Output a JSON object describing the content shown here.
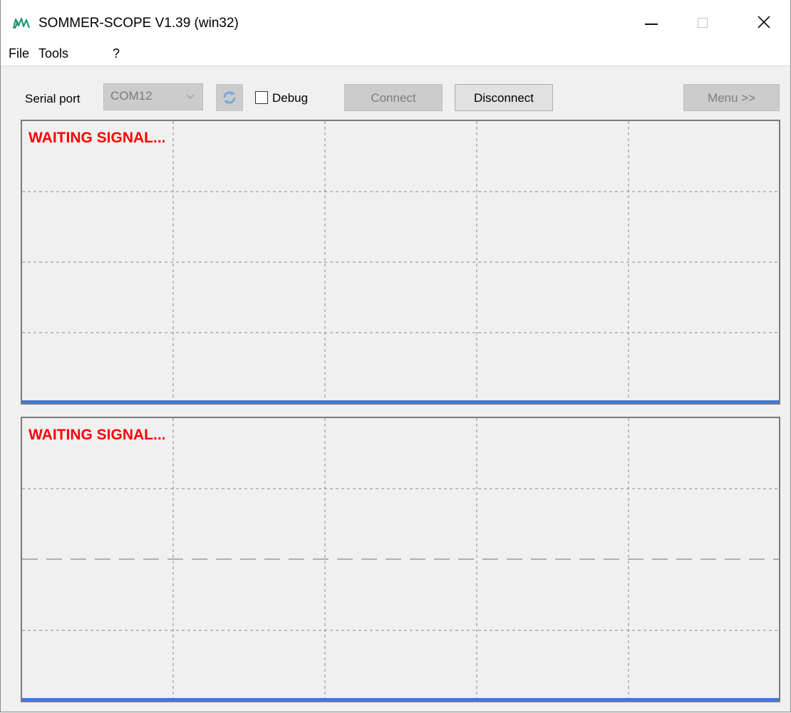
{
  "window": {
    "title": "SOMMER-SCOPE V1.39 (win32)",
    "icon": "app-logo-icon",
    "controls": [
      "minimize-icon",
      "maximize-icon",
      "close-icon"
    ]
  },
  "menu": {
    "file": "File",
    "tools": "Tools",
    "help": "?"
  },
  "toolbar": {
    "serial_port_label": "Serial port",
    "serial_port_value": "COM12",
    "refresh_icon": "refresh-icon",
    "debug_label": "Debug",
    "debug_checked": false,
    "connect_label": "Connect",
    "disconnect_label": "Disconnect",
    "menu_label": "Menu >>"
  },
  "scopes": [
    {
      "status": "WAITING SIGNAL..."
    },
    {
      "status": "WAITING SIGNAL..."
    }
  ],
  "colors": {
    "status_text": "#ff0000",
    "trace_line": "#3c78d8",
    "grid_line": "#8a8a8a"
  }
}
